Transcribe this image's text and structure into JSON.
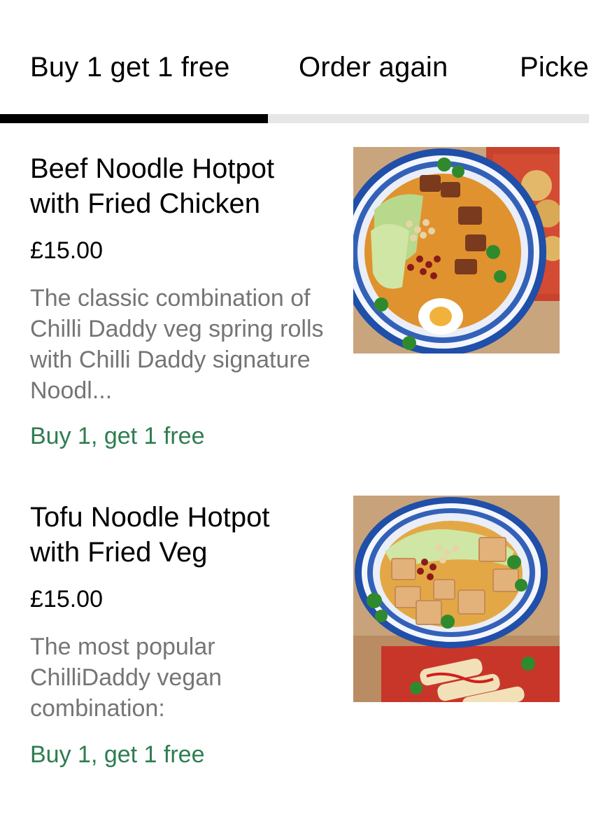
{
  "tabs": [
    {
      "label": "Buy 1 get 1 free",
      "selected": true
    },
    {
      "label": "Order again",
      "selected": false
    },
    {
      "label": "Picke",
      "selected": false
    }
  ],
  "items": [
    {
      "title": "Beef Noodle Hotpot with Fried Chicken",
      "price": "£15.00",
      "description": "The classic combination of Chilli Daddy veg spring rolls with Chilli Daddy signature Noodl...",
      "promo": "Buy 1, get 1 free"
    },
    {
      "title": "Tofu Noodle Hotpot with Fried Veg",
      "price": "£15.00",
      "description": "The most popular ChilliDaddy vegan combination:",
      "promo": "Buy 1, get 1 free"
    }
  ],
  "colors": {
    "text_primary": "#000000",
    "text_secondary": "#757575",
    "promo_green": "#2e7d4f",
    "tab_indicator": "#000000",
    "tab_track": "#e6e6e6"
  }
}
